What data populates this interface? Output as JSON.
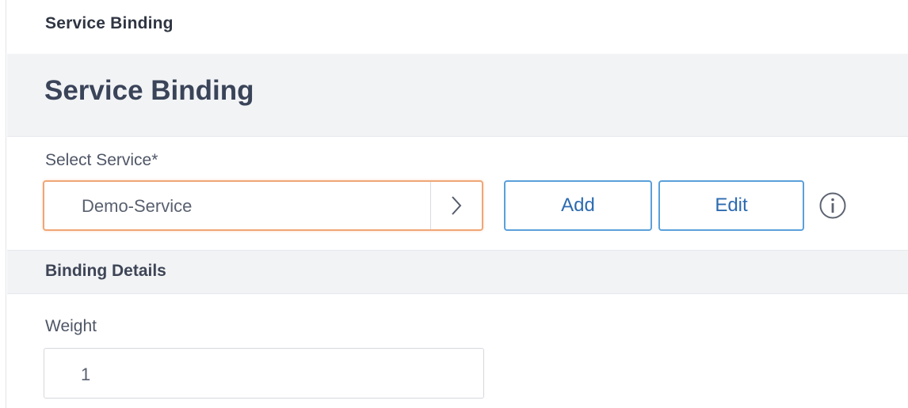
{
  "breadcrumb": "Service Binding",
  "page_title": "Service Binding",
  "select_service": {
    "label": "Select Service*",
    "value": "Demo-Service",
    "arrow_icon": "chevron-right-icon"
  },
  "actions": {
    "add_label": "Add",
    "edit_label": "Edit",
    "info_icon": "info-circle-icon"
  },
  "binding_details": {
    "title": "Binding Details",
    "weight_label": "Weight",
    "weight_value": "1"
  },
  "colors": {
    "select_border": "#f0a676",
    "button_border": "#5aa0db",
    "button_text": "#2c6bb0",
    "band_background": "#f2f3f5"
  }
}
